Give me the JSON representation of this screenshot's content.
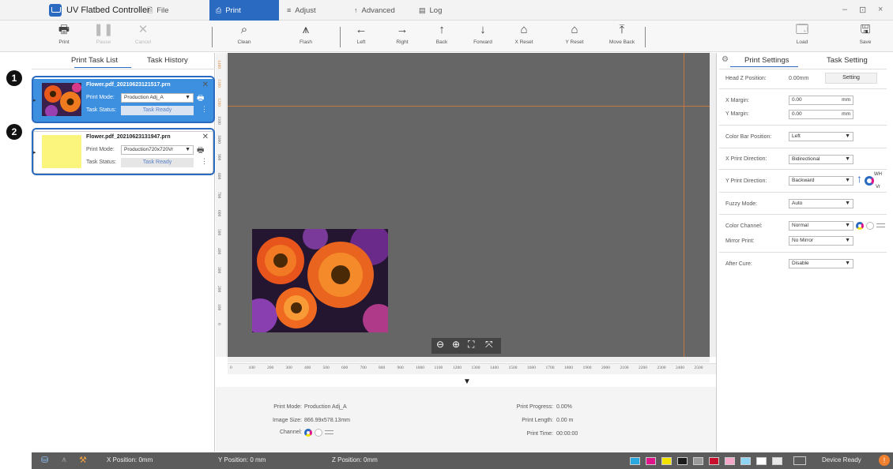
{
  "app": {
    "title": "UV Flatbed Controller"
  },
  "menu": [
    {
      "label": "File",
      "icon": "file-icon"
    },
    {
      "label": "Print",
      "icon": "print-icon",
      "active": true
    },
    {
      "label": "Adjust",
      "icon": "adjust-icon"
    },
    {
      "label": "Advanced",
      "icon": "advanced-icon"
    },
    {
      "label": "Log",
      "icon": "log-icon"
    }
  ],
  "window_controls": [
    "–",
    "⊡",
    "×"
  ],
  "toolbar": {
    "print": "Print",
    "pause": "Pause",
    "cancel": "Cancel",
    "clean": "Clean",
    "flash": "Flash",
    "left": "Left",
    "right": "Right",
    "back": "Back",
    "forward": "Forward",
    "x_reset": "X Reset",
    "y_reset": "Y Reset",
    "move_back": "Move Back",
    "load": "Load",
    "save": "Save"
  },
  "left_tabs": {
    "task_list": "Print Task List",
    "task_history": "Task History"
  },
  "tasks": [
    {
      "filename": "Flower.pdf_20210623121517.prn",
      "mode_label": "Print Mode:",
      "mode": "Production Adj_A",
      "status_label": "Task Status:",
      "status": "Task Ready",
      "selected": true
    },
    {
      "filename": "Flower.pdf_20210623131947.prn",
      "mode_label": "Print Mode:",
      "mode": "Production720x720Vr",
      "status_label": "Task Status:",
      "status": "Task Ready",
      "selected": false
    }
  ],
  "callouts": [
    "1",
    "2"
  ],
  "ruler": {
    "vertical": [
      "1400",
      "1300",
      "1200",
      "1100",
      "1000",
      "900",
      "800",
      "700",
      "600",
      "500",
      "400",
      "300",
      "200",
      "100",
      "0"
    ],
    "horizontal": [
      "0",
      "100",
      "200",
      "300",
      "400",
      "500",
      "600",
      "700",
      "800",
      "900",
      "1000",
      "1100",
      "1200",
      "1300",
      "1400",
      "1500",
      "1600",
      "1700",
      "1800",
      "1900",
      "2000",
      "2100",
      "2200",
      "2300",
      "2400",
      "2500"
    ]
  },
  "info": {
    "print_mode_label": "Print Mode:",
    "print_mode": "Production Adj_A",
    "image_size_label": "Image Size:",
    "image_size": "866.99x578.13mm",
    "channel_label": "Channel:",
    "progress_label": "Print Progress:",
    "progress": "0.00%",
    "length_label": "Print Length:",
    "length": "0.00 m",
    "time_label": "Print Time:",
    "time": "00:00:00"
  },
  "right_tabs": {
    "print_settings": "Print Settings",
    "task_setting": "Task Setting"
  },
  "settings": {
    "head_z_label": "Head Z Position:",
    "head_z": "0.00mm",
    "setting_button": "Setting",
    "x_margin_label": "X Margin:",
    "x_margin": "0.00",
    "y_margin_label": "Y Margin:",
    "y_margin": "0.00",
    "unit": "mm",
    "color_bar_label": "Color Bar Position:",
    "color_bar": "Left",
    "x_dir_label": "X Print Direction:",
    "x_dir": "Bidirectional",
    "y_dir_label": "Y Print Direction:",
    "y_dir": "Backward",
    "wh": "WH",
    "vr": "Vr",
    "fuzzy_label": "Fuzzy Mode:",
    "fuzzy": "Auto",
    "color_channel_label": "Color Channel:",
    "color_channel": "Normal",
    "mirror_label": "Mirror Print:",
    "mirror": "No Mirror",
    "after_cure_label": "After Cure:",
    "after_cure": "Disable"
  },
  "status": {
    "x_pos": "X Position: 0mm",
    "y_pos": "Y Position: 0 mm",
    "z_pos": "Z Position: 0mm",
    "device": "Device Ready",
    "ink_colors": [
      "#29a8e0",
      "#e0158a",
      "#f2e400",
      "#1a1a1a",
      "#9a9a9a",
      "#c8102e",
      "#f4a6c8",
      "#8fd3f2",
      "#ffffff",
      "#e8e8e8"
    ]
  }
}
